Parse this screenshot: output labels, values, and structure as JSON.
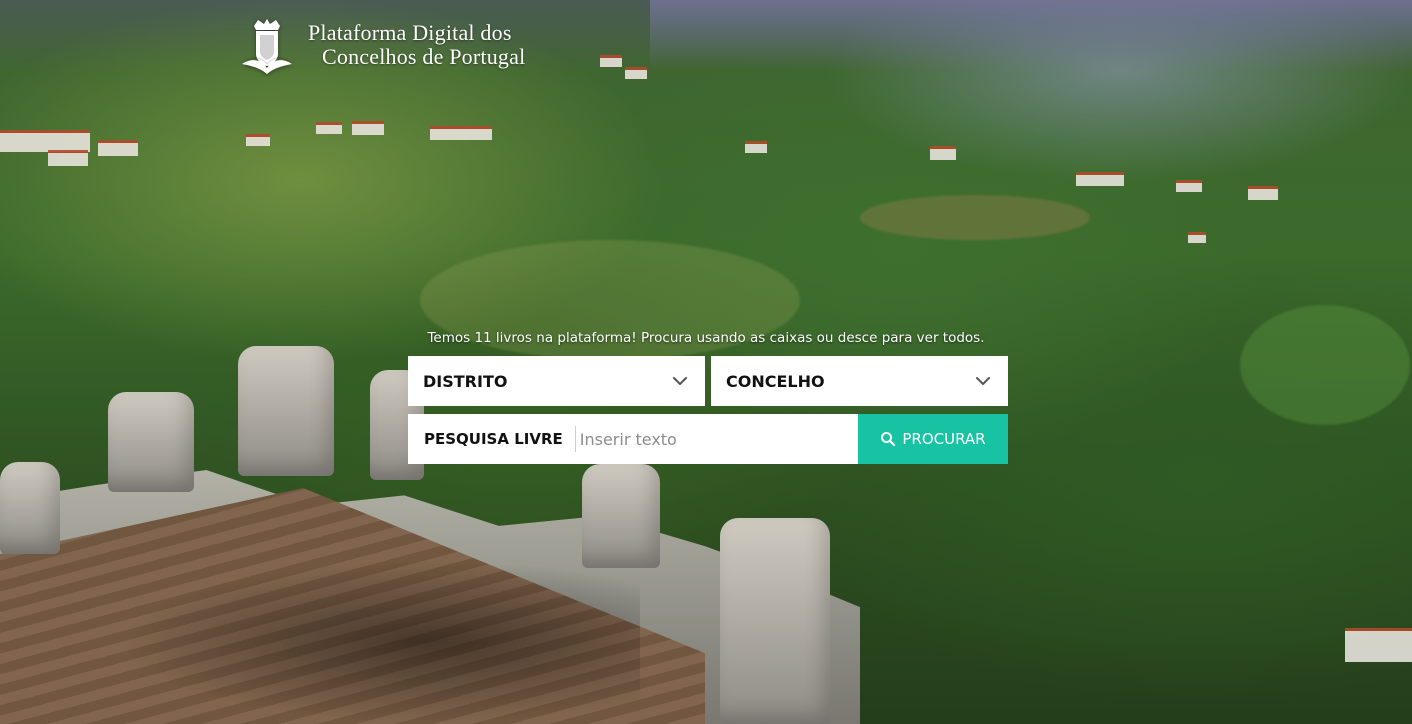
{
  "brand": {
    "title_line1": "Plataforma Digital dos",
    "title_line2": "Concelhos de Portugal",
    "logo_icon": "crest-shield-icon"
  },
  "hero": {
    "tagline": "Temos 11 livros na plataforma! Procura usando as caixas ou desce para ver todos."
  },
  "filters": {
    "district": {
      "label": "DISTRITO",
      "icon": "chevron-down-icon"
    },
    "council": {
      "label": "CONCELHO",
      "icon": "chevron-down-icon"
    }
  },
  "search": {
    "label": "PESQUISA LIVRE",
    "placeholder": "Inserir texto",
    "value": "",
    "button_label": "PROCURAR",
    "button_icon": "search-icon"
  },
  "colors": {
    "accent": "#17c3a2",
    "panel": "#ffffff",
    "text": "#111111"
  }
}
